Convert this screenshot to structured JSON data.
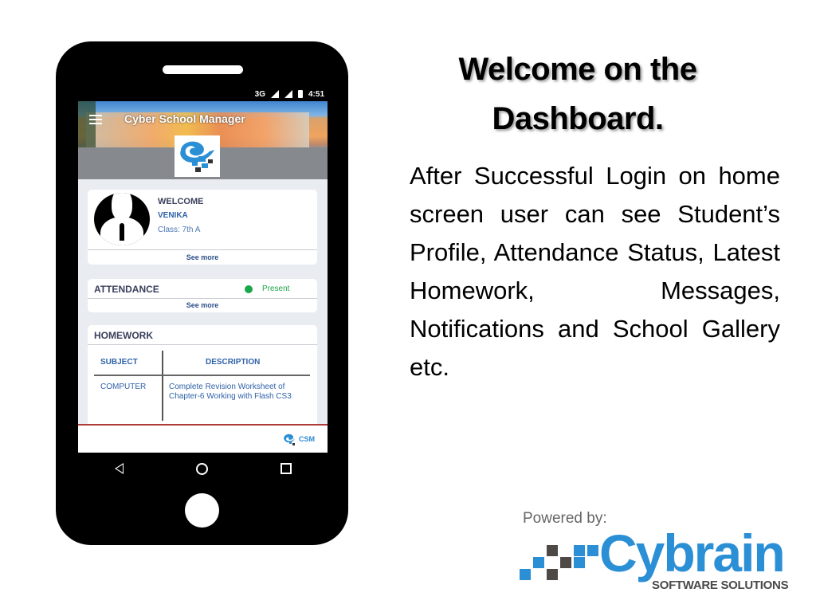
{
  "slide": {
    "title": "Welcome on the Dashboard.",
    "description": "After Successful Login on home screen user can see Student’s Profile, Attendance Status, Latest Homework, Messages, Notifications and School Gallery etc.",
    "powered_by_label": "Powered by:",
    "brand": {
      "name": "Cybrain",
      "tagline": "SOFTWARE SOLUTIONS",
      "color": "#2b8fd6"
    }
  },
  "phone": {
    "statusbar": {
      "network": "3G",
      "time": "4:51",
      "icons": [
        "signal-icon",
        "signal-icon",
        "battery-icon"
      ]
    },
    "app": {
      "title": "Cyber School Manager",
      "menu_icon": "hamburger-menu-icon",
      "profile": {
        "welcome": "WELCOME",
        "name": "VENIKA",
        "class": "Class: 7th A",
        "see_more": "See more"
      },
      "attendance": {
        "label": "ATTENDANCE",
        "status": "Present",
        "status_color": "#1aa64b",
        "see_more": "See more"
      },
      "homework": {
        "label": "HOMEWORK",
        "columns": [
          "SUBJECT",
          "DESCRIPTION"
        ],
        "rows": [
          {
            "subject": "COMPUTER",
            "description": "Complete Revision Worksheet of Chapter-6 Working with Flash CS3"
          }
        ]
      },
      "footer_logo": "CSM"
    },
    "navbar": [
      "back-icon",
      "home-icon",
      "recent-apps-icon"
    ]
  }
}
